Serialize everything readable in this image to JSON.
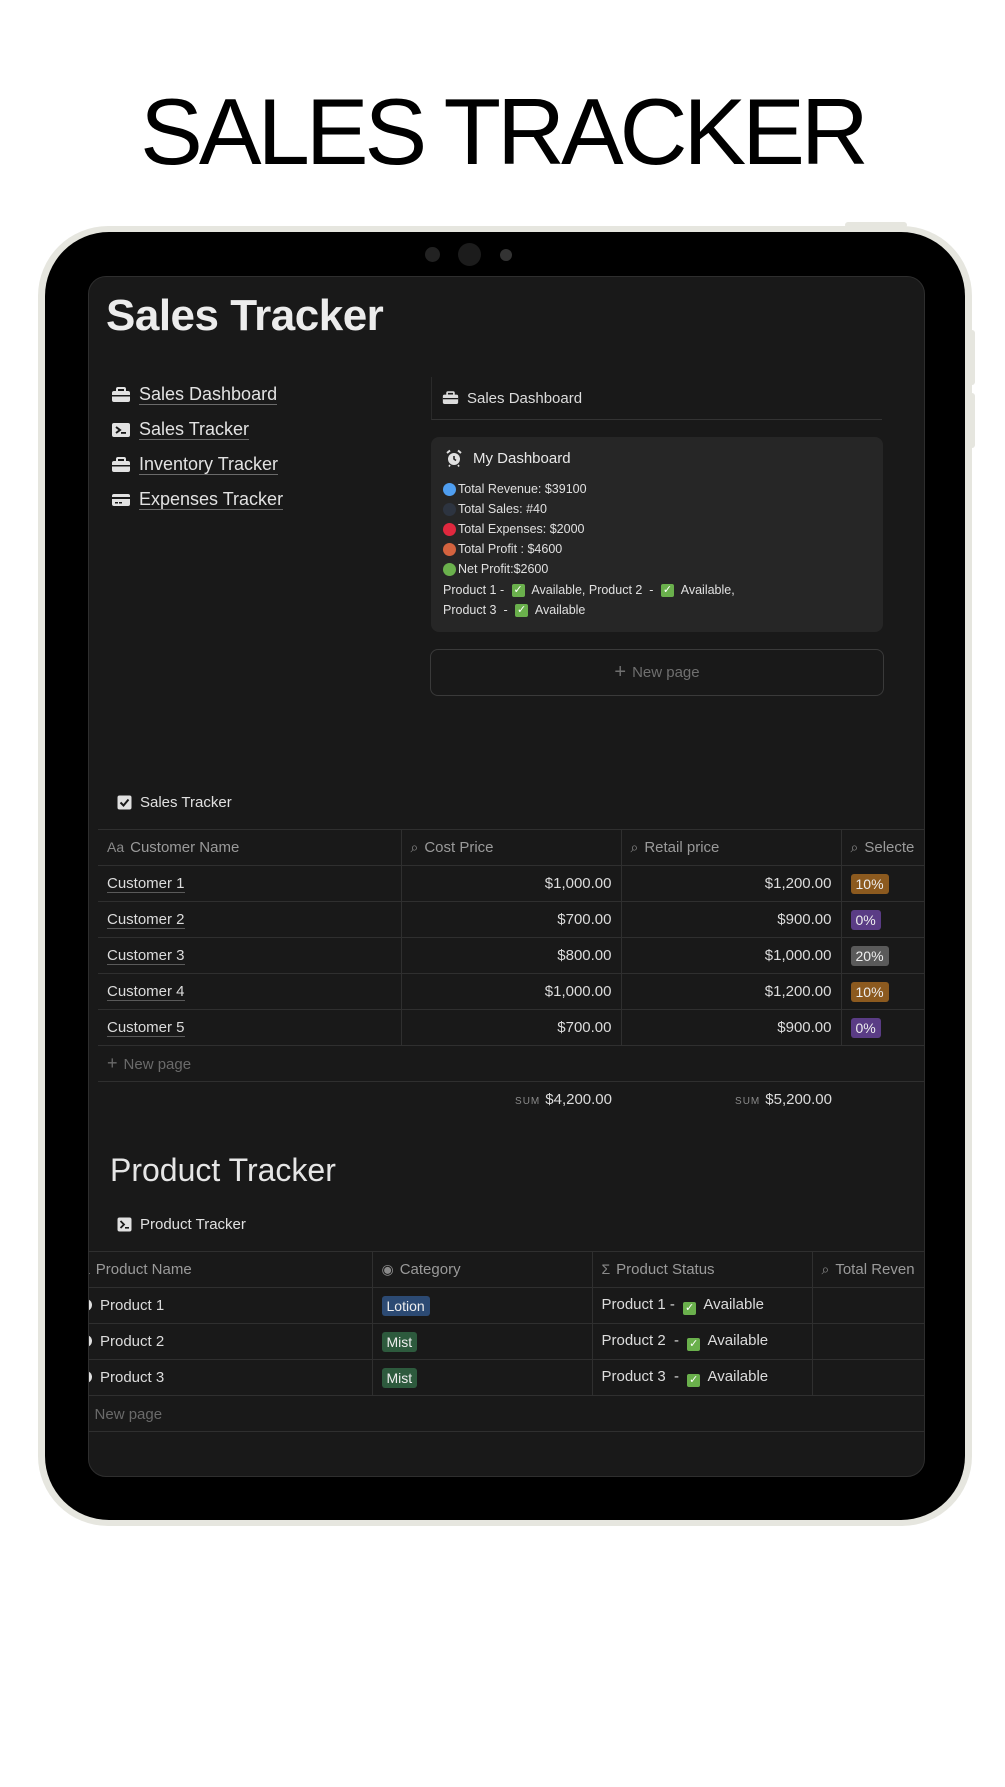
{
  "hero": {
    "title": "SALES TRACKER"
  },
  "page": {
    "title": "Sales Tracker"
  },
  "nav": {
    "items": [
      {
        "label": "Sales Dashboard",
        "icon": "briefcase-icon"
      },
      {
        "label": "Sales Tracker",
        "icon": "terminal-icon"
      },
      {
        "label": "Inventory Tracker",
        "icon": "briefcase-icon"
      },
      {
        "label": "Expenses Tracker",
        "icon": "card-icon"
      }
    ]
  },
  "gallery": {
    "title": "Sales Dashboard",
    "card": {
      "title": "My Dashboard",
      "stats": [
        {
          "text": "Total Revenue:  $39100",
          "color": "#4f9ef0"
        },
        {
          "text": "Total Sales: #40",
          "color": "#2d3440"
        },
        {
          "text": "Total Expenses:  $2000",
          "color": "#e0283e"
        },
        {
          "text": " Total Profit :  $4600",
          "color": "#d4633f"
        },
        {
          "text": "Net Profit:$2600",
          "color": "#6ab04c"
        }
      ],
      "products_line1": {
        "a": "Product 1 - ",
        "b": " Available, Product 2  - ",
        "c": " Available,"
      },
      "products_line2": {
        "a": "Product 3  - ",
        "b": " Available"
      }
    },
    "new_page": "New page"
  },
  "sales_db": {
    "title": "Sales Tracker",
    "headers": [
      "Customer Name",
      "Cost Price",
      "Retail price",
      "Selecte"
    ],
    "rows": [
      {
        "name": "Customer 1",
        "cost": "$1,000.00",
        "retail": "$1,200.00",
        "tag": "10%",
        "tag_color": "#8c5a1f"
      },
      {
        "name": "Customer 2",
        "cost": "$700.00",
        "retail": "$900.00",
        "tag": "0%",
        "tag_color": "#5a3c85"
      },
      {
        "name": "Customer 3",
        "cost": "$800.00",
        "retail": "$1,000.00",
        "tag": "20%",
        "tag_color": "#5a5a5a"
      },
      {
        "name": "Customer 4",
        "cost": "$1,000.00",
        "retail": "$1,200.00",
        "tag": "10%",
        "tag_color": "#8c5a1f"
      },
      {
        "name": "Customer 5",
        "cost": "$700.00",
        "retail": "$900.00",
        "tag": "0%",
        "tag_color": "#5a3c85"
      }
    ],
    "new_page": "New page",
    "sum_label": "SUM",
    "sum_cost": "$4,200.00",
    "sum_retail": "$5,200.00"
  },
  "product_section": {
    "heading": "Product Tracker"
  },
  "product_db": {
    "title": "Product Tracker",
    "headers": [
      "Product Name",
      "Category",
      "Product Status",
      "Total Reven"
    ],
    "rows": [
      {
        "name": "Product 1",
        "category": "Lotion",
        "cat_color": "#2c4a73",
        "status_a": "Product 1 - ",
        "status_b": " Available"
      },
      {
        "name": "Product 2",
        "category": "Mist",
        "cat_color": "#2d5a3d",
        "status_a": "Product 2  - ",
        "status_b": " Available"
      },
      {
        "name": "Product 3",
        "category": "Mist",
        "cat_color": "#2d5a3d",
        "status_a": "Product 3  - ",
        "status_b": " Available"
      }
    ],
    "new_page": "New page"
  }
}
